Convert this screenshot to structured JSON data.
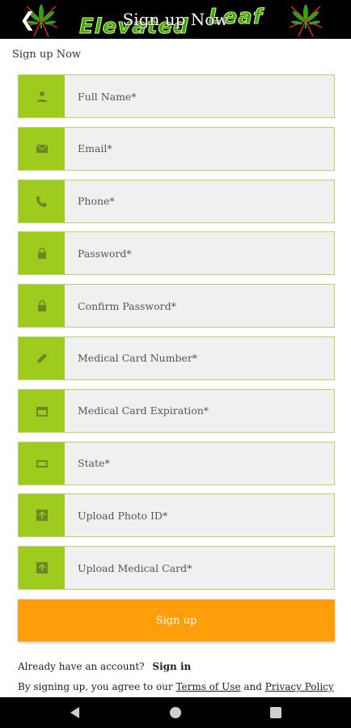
{
  "header": {
    "back_icon": "back-arrow-icon",
    "title": "Sign up Now",
    "brand_word1": "Elevated",
    "brand_word2": "Leaf"
  },
  "subtitle": "Sign up Now",
  "form": {
    "fields": [
      {
        "placeholder": "Full Name*",
        "icon": "person-icon"
      },
      {
        "placeholder": "Email*",
        "icon": "mail-icon"
      },
      {
        "placeholder": "Phone*",
        "icon": "phone-icon"
      },
      {
        "placeholder": "Password*",
        "icon": "lock-icon"
      },
      {
        "placeholder": "Confirm Password*",
        "icon": "lock-icon"
      },
      {
        "placeholder": "Medical Card Number*",
        "icon": "pencil-icon"
      },
      {
        "placeholder": "Medical Card Expiration*",
        "icon": "calendar-icon"
      },
      {
        "placeholder": "State*",
        "icon": "location-icon"
      },
      {
        "placeholder": "Upload Photo ID*",
        "icon": "upload-icon"
      },
      {
        "placeholder": "Upload Medical Card*",
        "icon": "upload-icon"
      }
    ],
    "submit_label": "Sign up"
  },
  "footer": {
    "account_text": "Already have an account?",
    "signin_label": "Sign in",
    "terms_prefix": "By signing up, you agree to our",
    "terms_link": "Terms of Use",
    "and_text": "and",
    "privacy_link": "Privacy Policy"
  },
  "colors": {
    "accent_green": "#9fcb1f",
    "button_orange": "#ff9e0b",
    "header_bg": "#000000"
  }
}
